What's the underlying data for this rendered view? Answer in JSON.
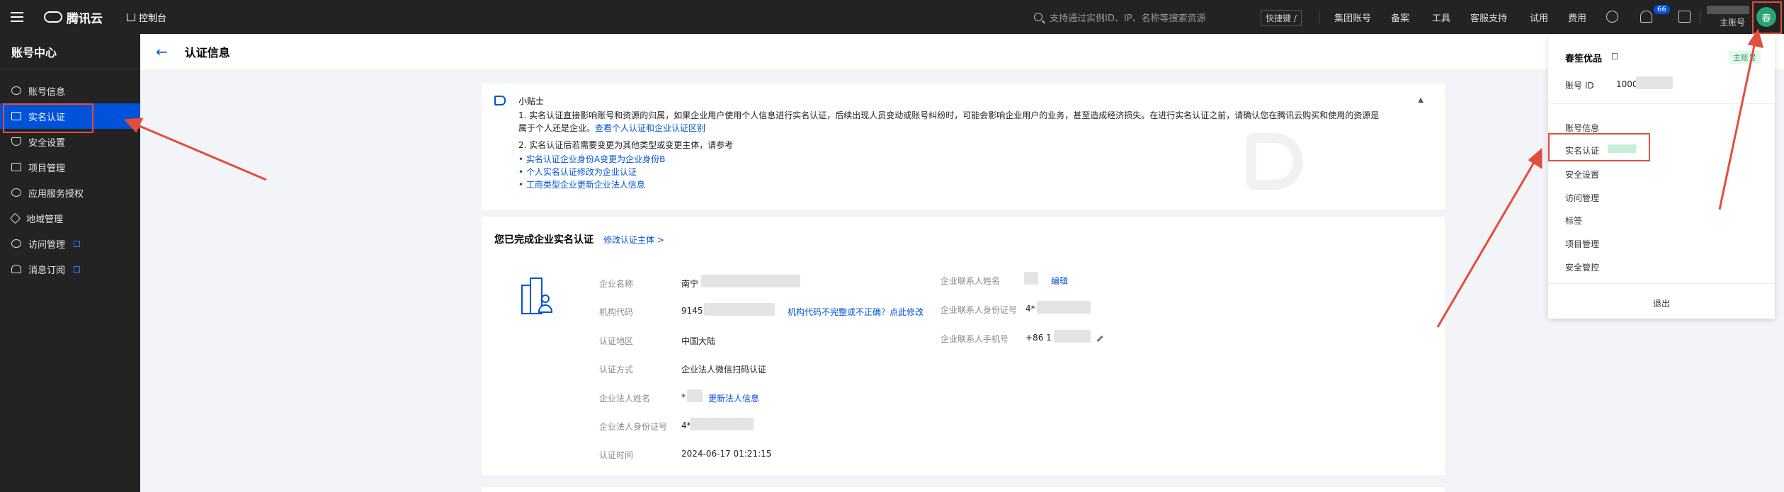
{
  "topbar": {
    "brand": "腾讯云",
    "console": "控制台",
    "search_placeholder": "支持通过实例ID、IP、名称等搜索资源",
    "shortcut": "快捷键 /",
    "nav": [
      "集团账号",
      "备案",
      "工具",
      "客服支持",
      "试用",
      "费用"
    ],
    "notification_count": "66",
    "main_account": "主账号",
    "avatar_text": "春"
  },
  "sidebar": {
    "title": "账号中心",
    "items": [
      {
        "label": "账号信息",
        "icon": "user-icon"
      },
      {
        "label": "实名认证",
        "icon": "id-card-icon"
      },
      {
        "label": "安全设置",
        "icon": "shield-icon"
      },
      {
        "label": "项目管理",
        "icon": "folder-icon"
      },
      {
        "label": "应用服务授权",
        "icon": "key-icon"
      },
      {
        "label": "地域管理",
        "icon": "layers-icon"
      },
      {
        "label": "访问管理",
        "icon": "gear-icon"
      },
      {
        "label": "消息订阅",
        "icon": "bell-icon"
      }
    ]
  },
  "page": {
    "title": "认证信息"
  },
  "tips": {
    "title": "小贴士",
    "line1": "1. 实名认证直接影响账号和资源的归属，如果企业用户使用个人信息进行实名认证，后续出现人员变动或账号纠纷时，可能会影响企业用户的业务，甚至造成经济损失。在进行实名认证之前，请确认您在腾讯云购买和使用的资源是",
    "line1b": "属于个人还是企业。",
    "line1_link": "查看个人认证和企业认证区别",
    "line2": "2. 实名认证后若需要变更为其他类型或变更主体，请参考",
    "links": [
      "实名认证企业身份A变更为企业身份B",
      "个人实名认证修改为企业认证",
      "工商类型企业更新企业法人信息"
    ]
  },
  "info": {
    "title": "您已完成企业实名认证",
    "modify": "修改认证主体 >",
    "company_name_label": "企业名称",
    "company_name_value": "南宁",
    "org_code_label": "机构代码",
    "org_code_value": "9145",
    "org_code_link": "机构代码不完整或不正确？点此修改",
    "region_label": "认证地区",
    "region_value": "中国大陆",
    "method_label": "认证方式",
    "method_value": "企业法人微信扫码认证",
    "legal_name_label": "企业法人姓名",
    "legal_name_value": "*",
    "legal_name_link": "更新法人信息",
    "legal_id_label": "企业法人身份证号",
    "legal_id_value": "4*",
    "time_label": "认证时间",
    "time_value": "2024-06-17 01:21:15",
    "contact_name_label": "企业联系人姓名",
    "contact_edit": "编辑",
    "contact_id_label": "企业联系人身份证号",
    "contact_id_value": "4*",
    "contact_phone_label": "企业联系人手机号",
    "contact_phone_value": "+86 1"
  },
  "panel": {
    "name": "春笙优品",
    "tag": "主账号",
    "account_id_label": "账号 ID",
    "account_id_value": "1000",
    "items": [
      "账号信息",
      "实名认证",
      "安全设置",
      "访问管理",
      "标签",
      "项目管理",
      "安全管控"
    ],
    "logout": "退出"
  },
  "colors": {
    "accent": "#0052d9",
    "annotation": "#e34d3b",
    "sidebar_bg": "#232323"
  }
}
